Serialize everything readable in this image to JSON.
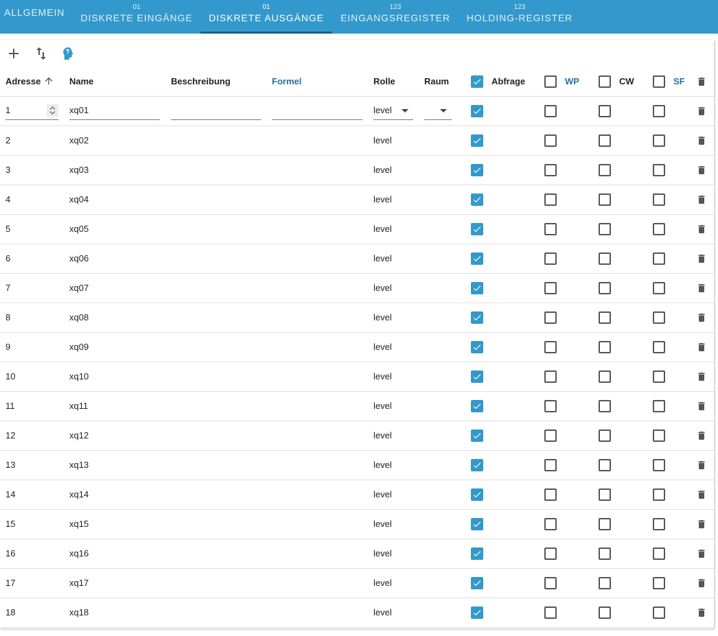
{
  "tabs": [
    {
      "label": "ALLGEMEIN",
      "sup": "",
      "active": false
    },
    {
      "label": "DISKRETE EINGÄNGE",
      "sup": "01",
      "active": false
    },
    {
      "label": "DISKRETE AUSGÄNGE",
      "sup": "01",
      "active": true
    },
    {
      "label": "EINGANGSREGISTER",
      "sup": "123",
      "active": false
    },
    {
      "label": "HOLDING-REGISTER",
      "sup": "123",
      "active": false
    }
  ],
  "toolbar": {
    "add_icon": "plus-icon",
    "sort_icon": "swap-vertical-icon",
    "ai_icon": "head-profile-icon"
  },
  "columns": {
    "adresse": "Adresse",
    "name": "Name",
    "beschreibung": "Beschreibung",
    "formel": "Formel",
    "rolle": "Rolle",
    "raum": "Raum",
    "abfrage": "Abfrage",
    "wp": "WP",
    "cw": "CW",
    "sf": "SF"
  },
  "colors": {
    "accent": "#3399cc",
    "link_header": "#2a6ea6"
  },
  "header_checks": {
    "abfrage": true,
    "wp": false,
    "cw": false,
    "sf": false
  },
  "edit_row": {
    "adresse": "1",
    "name": "xq01",
    "beschreibung": "",
    "formel": "",
    "rolle": "level",
    "raum": "",
    "abfrage": true,
    "wp": false,
    "cw": false,
    "sf": false
  },
  "rows": [
    {
      "adresse": "2",
      "name": "xq02",
      "rolle": "level",
      "abfrage": true,
      "wp": false,
      "cw": false,
      "sf": false
    },
    {
      "adresse": "3",
      "name": "xq03",
      "rolle": "level",
      "abfrage": true,
      "wp": false,
      "cw": false,
      "sf": false
    },
    {
      "adresse": "4",
      "name": "xq04",
      "rolle": "level",
      "abfrage": true,
      "wp": false,
      "cw": false,
      "sf": false
    },
    {
      "adresse": "5",
      "name": "xq05",
      "rolle": "level",
      "abfrage": true,
      "wp": false,
      "cw": false,
      "sf": false
    },
    {
      "adresse": "6",
      "name": "xq06",
      "rolle": "level",
      "abfrage": true,
      "wp": false,
      "cw": false,
      "sf": false
    },
    {
      "adresse": "7",
      "name": "xq07",
      "rolle": "level",
      "abfrage": true,
      "wp": false,
      "cw": false,
      "sf": false
    },
    {
      "adresse": "8",
      "name": "xq08",
      "rolle": "level",
      "abfrage": true,
      "wp": false,
      "cw": false,
      "sf": false
    },
    {
      "adresse": "9",
      "name": "xq09",
      "rolle": "level",
      "abfrage": true,
      "wp": false,
      "cw": false,
      "sf": false
    },
    {
      "adresse": "10",
      "name": "xq10",
      "rolle": "level",
      "abfrage": true,
      "wp": false,
      "cw": false,
      "sf": false
    },
    {
      "adresse": "11",
      "name": "xq11",
      "rolle": "level",
      "abfrage": true,
      "wp": false,
      "cw": false,
      "sf": false
    },
    {
      "adresse": "12",
      "name": "xq12",
      "rolle": "level",
      "abfrage": true,
      "wp": false,
      "cw": false,
      "sf": false
    },
    {
      "adresse": "13",
      "name": "xq13",
      "rolle": "level",
      "abfrage": true,
      "wp": false,
      "cw": false,
      "sf": false
    },
    {
      "adresse": "14",
      "name": "xq14",
      "rolle": "level",
      "abfrage": true,
      "wp": false,
      "cw": false,
      "sf": false
    },
    {
      "adresse": "15",
      "name": "xq15",
      "rolle": "level",
      "abfrage": true,
      "wp": false,
      "cw": false,
      "sf": false
    },
    {
      "adresse": "16",
      "name": "xq16",
      "rolle": "level",
      "abfrage": true,
      "wp": false,
      "cw": false,
      "sf": false
    },
    {
      "adresse": "17",
      "name": "xq17",
      "rolle": "level",
      "abfrage": true,
      "wp": false,
      "cw": false,
      "sf": false
    },
    {
      "adresse": "18",
      "name": "xq18",
      "rolle": "level",
      "abfrage": true,
      "wp": false,
      "cw": false,
      "sf": false
    }
  ]
}
